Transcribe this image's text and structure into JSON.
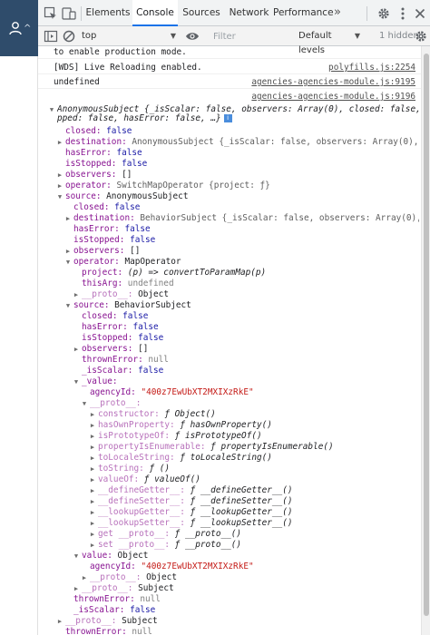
{
  "toolbar": {
    "tabs": [
      "Elements",
      "Console",
      "Sources",
      "Network",
      "Performance"
    ],
    "more_tabs": "»"
  },
  "filterbar": {
    "context": "top",
    "filter_placeholder": "Filter",
    "levels": "Default levels",
    "hidden_count": "1 hidden"
  },
  "console": {
    "messages": [
      {
        "text": "to enable production mode.",
        "source": ""
      },
      {
        "text": "[WDS] Live Reloading enabled.",
        "source": "polyfills.js:2254"
      },
      {
        "text": "undefined",
        "source": "agencies-agencies-module.js:9195"
      },
      {
        "text": "",
        "source": "agencies-agencies-module.js:9196"
      }
    ],
    "object": {
      "header1": "AnonymousSubject {_isScalar: false, observers: Array(0), closed: false, isSto",
      "header2": "pped: false, hasError: false, …}",
      "lines": [
        {
          "t": "",
          "k": "closed",
          "v": "false",
          "c": "v-bool"
        },
        {
          "t": "▶",
          "k": "destination",
          "v": "AnonymousSubject {_isScalar: false, observers: Array(0), clos…",
          "c": "v-gray"
        },
        {
          "t": "",
          "k": "hasError",
          "v": "false",
          "c": "v-bool"
        },
        {
          "t": "",
          "k": "isStopped",
          "v": "false",
          "c": "v-bool"
        },
        {
          "t": "▶",
          "k": "observers",
          "v": "[]",
          "c": ""
        },
        {
          "t": "▶",
          "k": "operator",
          "v": "SwitchMapOperator {project: ƒ}",
          "c": "v-gray"
        },
        {
          "t": "▼",
          "k": "source",
          "v": "AnonymousSubject",
          "c": ""
        },
        {
          "t": "",
          "k": "closed",
          "v": "false",
          "c": "v-bool"
        },
        {
          "t": "▶",
          "k": "destination",
          "v": "BehaviorSubject {_isScalar: false, observers: Array(0), clos…",
          "c": "v-gray"
        },
        {
          "t": "",
          "k": "hasError",
          "v": "false",
          "c": "v-bool"
        },
        {
          "t": "",
          "k": "isStopped",
          "v": "false",
          "c": "v-bool"
        },
        {
          "t": "▶",
          "k": "observers",
          "v": "[]",
          "c": ""
        },
        {
          "t": "▼",
          "k": "operator",
          "v": "MapOperator",
          "c": ""
        },
        {
          "t": "",
          "k": "project",
          "v": "(p) => convertToParamMap(p)",
          "c": "v-fn"
        },
        {
          "t": "",
          "k": "thisArg",
          "v": "undefined",
          "c": "v-null"
        },
        {
          "t": "▶",
          "k": "__proto__",
          "v": "Object",
          "c": ""
        },
        {
          "t": "▼",
          "k": "source",
          "v": "BehaviorSubject",
          "c": ""
        },
        {
          "t": "",
          "k": "closed",
          "v": "false",
          "c": "v-bool"
        },
        {
          "t": "",
          "k": "hasError",
          "v": "false",
          "c": "v-bool"
        },
        {
          "t": "",
          "k": "isStopped",
          "v": "false",
          "c": "v-bool"
        },
        {
          "t": "▶",
          "k": "observers",
          "v": "[]",
          "c": ""
        },
        {
          "t": "",
          "k": "thrownError",
          "v": "null",
          "c": "v-null"
        },
        {
          "t": "",
          "k": "_isScalar",
          "v": "false",
          "c": "v-bool"
        },
        {
          "t": "▼",
          "k": "_value",
          "v": "",
          "c": ""
        },
        {
          "t": "",
          "k": "agencyId",
          "v": "\"400z7EwUbXT2MXIXzRkE\"",
          "c": "v-str"
        },
        {
          "t": "▼",
          "k": "__proto__",
          "v": "",
          "c": ""
        },
        {
          "t": "▶",
          "k": "constructor",
          "v": "ƒ Object()",
          "c": "v-fn"
        },
        {
          "t": "▶",
          "k": "hasOwnProperty",
          "v": "ƒ hasOwnProperty()",
          "c": "v-fn"
        },
        {
          "t": "▶",
          "k": "isPrototypeOf",
          "v": "ƒ isPrototypeOf()",
          "c": "v-fn"
        },
        {
          "t": "▶",
          "k": "propertyIsEnumerable",
          "v": "ƒ propertyIsEnumerable()",
          "c": "v-fn"
        },
        {
          "t": "▶",
          "k": "toLocaleString",
          "v": "ƒ toLocaleString()",
          "c": "v-fn"
        },
        {
          "t": "▶",
          "k": "toString",
          "v": "ƒ ()",
          "c": "v-fn"
        },
        {
          "t": "▶",
          "k": "valueOf",
          "v": "ƒ valueOf()",
          "c": "v-fn"
        },
        {
          "t": "▶",
          "k": "__defineGetter__",
          "v": "ƒ __defineGetter__()",
          "c": "v-fn"
        },
        {
          "t": "▶",
          "k": "__defineSetter__",
          "v": "ƒ __defineSetter__()",
          "c": "v-fn"
        },
        {
          "t": "▶",
          "k": "__lookupGetter__",
          "v": "ƒ __lookupGetter__()",
          "c": "v-fn"
        },
        {
          "t": "▶",
          "k": "__lookupSetter__",
          "v": "ƒ __lookupSetter__()",
          "c": "v-fn"
        },
        {
          "t": "▶",
          "k": "get __proto__",
          "v": "ƒ __proto__()",
          "c": "v-fn"
        },
        {
          "t": "▶",
          "k": "set __proto__",
          "v": "ƒ __proto__()",
          "c": "v-fn"
        },
        {
          "t": "▼",
          "k": "value",
          "v": "Object",
          "c": ""
        },
        {
          "t": "",
          "k": "agencyId",
          "v": "\"400z7EwUbXT2MXIXzRkE\"",
          "c": "v-str"
        },
        {
          "t": "▶",
          "k": "__proto__",
          "v": "Object",
          "c": ""
        },
        {
          "t": "▶",
          "k": "__proto__",
          "v": "Subject",
          "c": ""
        },
        {
          "t": "",
          "k": "thrownError",
          "v": "null",
          "c": "v-null"
        },
        {
          "t": "",
          "k": "_isScalar",
          "v": "false",
          "c": "v-bool"
        },
        {
          "t": "▶",
          "k": "__proto__",
          "v": "Subject",
          "c": ""
        },
        {
          "t": "",
          "k": "thrownError",
          "v": "null",
          "c": "v-null"
        },
        {
          "t": "",
          "k": "_isScalar",
          "v": "false",
          "c": "v-bool"
        }
      ]
    }
  },
  "icons": {
    "user": "user-icon",
    "inspect": "inspect-element-icon",
    "device": "device-toolbar-icon",
    "settings": "gear-icon",
    "kebab": "more-vert-icon",
    "close": "close-icon",
    "sidebar": "console-sidebar-icon",
    "clear": "clear-console-icon",
    "eye": "eye-icon",
    "console_settings": "console-settings-icon",
    "info": "info-icon"
  },
  "colors": {
    "tab_accent": "#1a73e8",
    "property_key": "#881391",
    "boolean": "#1a1aa6",
    "string": "#c41a16",
    "header_bar": "#2f4c6b"
  }
}
